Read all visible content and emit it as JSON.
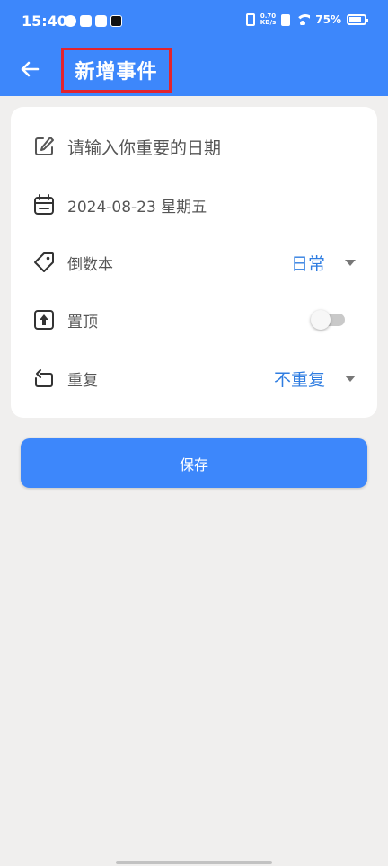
{
  "status_bar": {
    "time": "15:40",
    "net_speed_value": "0.70",
    "net_speed_unit": "KB/s",
    "battery": "75%"
  },
  "app_bar": {
    "title": "新增事件"
  },
  "form": {
    "date_placeholder": "请输入你重要的日期",
    "date_value": "2024-08-23 星期五",
    "category_label": "倒数本",
    "category_value": "日常",
    "pin_label": "置顶",
    "pin_enabled": false,
    "repeat_label": "重复",
    "repeat_value": "不重复"
  },
  "save_button": {
    "label": "保存"
  },
  "colors": {
    "primary": "#3d87fb",
    "value_text": "#2f7de1",
    "highlight_border": "#e3232d",
    "background": "#f0efee"
  }
}
